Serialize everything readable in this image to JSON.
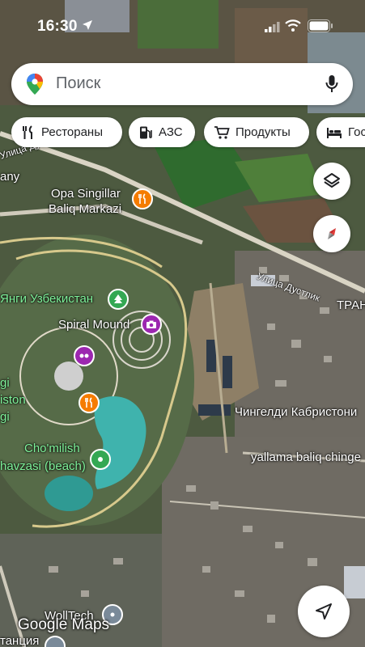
{
  "status_bar": {
    "time": "16:30"
  },
  "search": {
    "placeholder": "Поиск"
  },
  "chips": [
    {
      "label": "Рестораны",
      "icon": "fork-knife-icon"
    },
    {
      "label": "АЗС",
      "icon": "gas-station-icon"
    },
    {
      "label": "Продукты",
      "icon": "shopping-cart-icon"
    },
    {
      "label": "Гос",
      "icon": "bed-icon"
    }
  ],
  "labels": {
    "opa_1": "Opa Singillar",
    "opa_2": "Baliq Markazi",
    "yangi": "Янги Узбекистан",
    "spiral": "Spiral Mound",
    "chomilish_1": "Cho'milish",
    "chomilish_2": "havzasi (beach)",
    "chingeldi": "Чингелди Кабристони",
    "yallama": "yallama baliq chinge",
    "wolltech": "WollTech",
    "stantsiya": "танция",
    "trans": "ТРАН",
    "street_1": "Улица Дустлик",
    "street_2": "Улица Дустлик",
    "left_cut_1": "gi",
    "left_cut_2": "iston",
    "left_cut_3": "gi",
    "left_cut_4": "any",
    "brand": "Google Maps"
  },
  "colors": {
    "food_poi": "#f57c00",
    "park_poi": "#34a853",
    "attraction_poi": "#9c27b0",
    "compass_red": "#e53935",
    "label_green": "#7ef29a"
  }
}
